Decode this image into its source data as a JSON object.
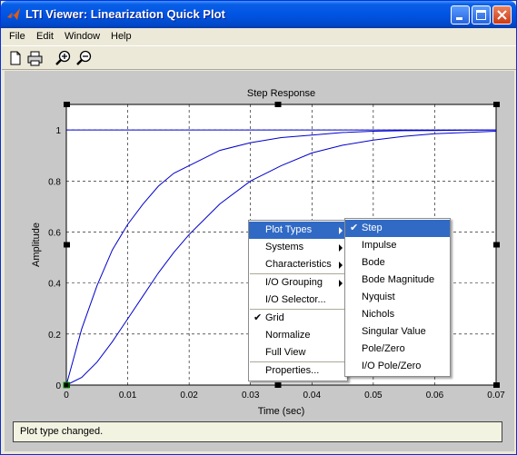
{
  "window": {
    "title": "LTI Viewer: Linearization Quick Plot"
  },
  "menubar": {
    "file": "File",
    "edit": "Edit",
    "window": "Window",
    "help": "Help"
  },
  "toolbar": {
    "icons": [
      "new-document-icon",
      "print-icon",
      "zoom-in-icon",
      "zoom-out-icon"
    ]
  },
  "chart_data": {
    "type": "line",
    "title": "Step Response",
    "xlabel": "Time (sec)",
    "ylabel": "Amplitude",
    "xlim": [
      0,
      0.07
    ],
    "ylim": [
      0,
      1.1
    ],
    "xticks": [
      "0",
      "0.01",
      "0.02",
      "0.03",
      "0.04",
      "0.05",
      "0.06",
      "0.07"
    ],
    "yticks": [
      "0",
      "0.2",
      "0.4",
      "0.6",
      "0.8",
      "1"
    ],
    "grid": true,
    "color": "#0000cc",
    "series": [
      {
        "x": [
          0,
          0.0025,
          0.005,
          0.0075,
          0.01,
          0.0125,
          0.015,
          0.0175,
          0.02,
          0.025,
          0.03,
          0.035,
          0.04,
          0.045,
          0.05,
          0.055,
          0.06,
          0.065,
          0.07
        ],
        "values": [
          0,
          0.22,
          0.39,
          0.53,
          0.63,
          0.71,
          0.78,
          0.83,
          0.86,
          0.92,
          0.95,
          0.97,
          0.98,
          0.99,
          0.995,
          0.997,
          0.998,
          0.999,
          1.0
        ]
      },
      {
        "x": [
          0,
          0.0025,
          0.005,
          0.0075,
          0.01,
          0.0125,
          0.015,
          0.0175,
          0.02,
          0.025,
          0.03,
          0.035,
          0.04,
          0.045,
          0.05,
          0.055,
          0.06,
          0.065,
          0.07
        ],
        "values": [
          0,
          0.03,
          0.09,
          0.17,
          0.26,
          0.35,
          0.44,
          0.52,
          0.59,
          0.71,
          0.8,
          0.86,
          0.91,
          0.94,
          0.96,
          0.975,
          0.985,
          0.99,
          0.995
        ]
      },
      {
        "x": [
          0,
          0.07
        ],
        "values": [
          1,
          1
        ]
      }
    ]
  },
  "context_menu": {
    "items": [
      {
        "label": "Plot Types",
        "submenu": true,
        "highlighted": true
      },
      {
        "label": "Systems",
        "submenu": true
      },
      {
        "label": "Characteristics",
        "submenu": true
      },
      {
        "label": "I/O Grouping",
        "submenu": true,
        "sep_before": true
      },
      {
        "label": "I/O Selector..."
      },
      {
        "label": "Grid",
        "checked": true,
        "sep_before": true
      },
      {
        "label": "Normalize"
      },
      {
        "label": "Full View"
      },
      {
        "label": "Properties...",
        "sep_before": true
      }
    ]
  },
  "plot_types_submenu": {
    "items": [
      {
        "label": "Step",
        "checked": true,
        "highlighted": true
      },
      {
        "label": "Impulse"
      },
      {
        "label": "Bode"
      },
      {
        "label": "Bode Magnitude"
      },
      {
        "label": "Nyquist"
      },
      {
        "label": "Nichols"
      },
      {
        "label": "Singular Value"
      },
      {
        "label": "Pole/Zero"
      },
      {
        "label": "I/O Pole/Zero"
      }
    ]
  },
  "status": {
    "text": "Plot type changed."
  }
}
